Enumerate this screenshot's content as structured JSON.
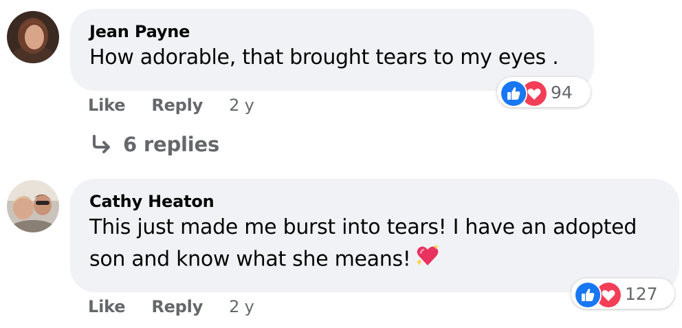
{
  "comments": [
    {
      "author": "Jean Payne",
      "text": "How adorable, that brought tears to my eyes .",
      "like_label": "Like",
      "reply_label": "Reply",
      "time": "2 y",
      "reactions": {
        "icons": [
          "like-icon",
          "love-icon"
        ],
        "count": "94"
      },
      "replies_label": "6 replies"
    },
    {
      "author": "Cathy Heaton",
      "text_line1": "This just made me burst into tears! I have an adopted",
      "text_line2": "son and know what she means!",
      "emoji": "sparkling-heart-emoji",
      "like_label": "Like",
      "reply_label": "Reply",
      "time": "2 y",
      "reactions": {
        "icons": [
          "like-icon",
          "love-icon"
        ],
        "count": "127"
      }
    }
  ],
  "colors": {
    "bubble": "#f0f2f5",
    "secondary_text": "#65676b",
    "like_blue": "#1877f2",
    "love_red": "#f33e58"
  }
}
